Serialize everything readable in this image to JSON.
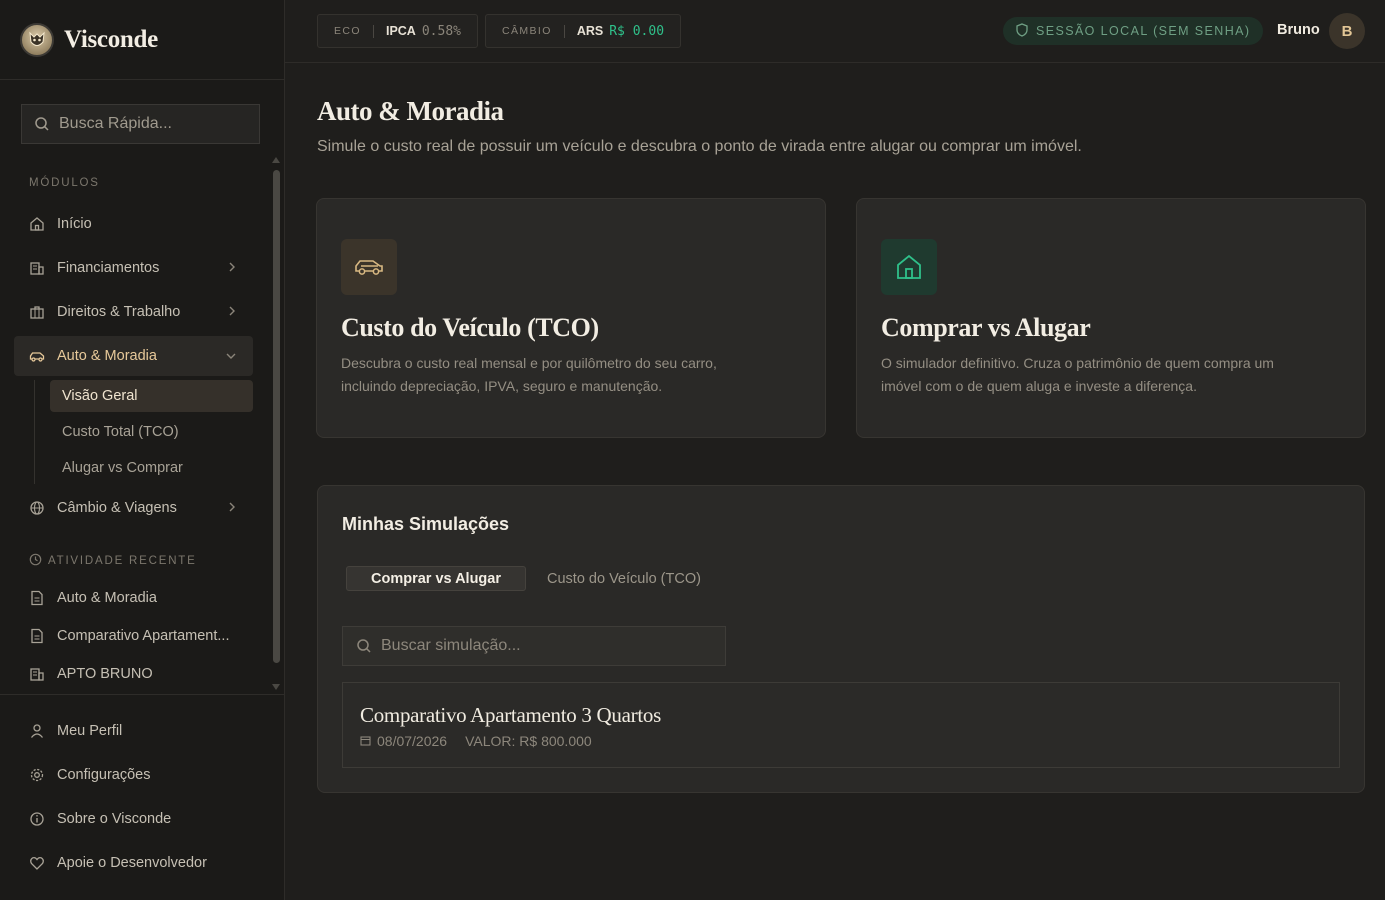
{
  "brand": {
    "name": "Visconde",
    "logo_icon": "owl-crest-icon"
  },
  "sidebar": {
    "search_placeholder": "Busca Rápida...",
    "modules_label": "MÓDULOS",
    "items": [
      {
        "label": "Início",
        "icon": "home-icon"
      },
      {
        "label": "Financiamentos",
        "icon": "building-icon"
      },
      {
        "label": "Direitos & Trabalho",
        "icon": "briefcase-icon"
      },
      {
        "label": "Auto & Moradia",
        "icon": "car-icon",
        "active": true
      },
      {
        "label": "Câmbio & Viagens",
        "icon": "globe-icon"
      }
    ],
    "subitems": [
      {
        "label": "Visão Geral",
        "active": true
      },
      {
        "label": "Custo Total (TCO)"
      },
      {
        "label": "Alugar vs Comprar"
      }
    ],
    "recent_label": "ATIVIDADE RECENTE",
    "recent": [
      {
        "label": "Auto & Moradia",
        "icon": "document-icon"
      },
      {
        "label": "Comparativo Apartament...",
        "icon": "document-icon"
      },
      {
        "label": "APTO BRUNO",
        "icon": "building-icon"
      }
    ],
    "bottom": [
      {
        "label": "Meu Perfil",
        "icon": "user-icon"
      },
      {
        "label": "Configurações",
        "icon": "gear-icon"
      },
      {
        "label": "Sobre o Visconde",
        "icon": "info-icon"
      },
      {
        "label": "Apoie o Desenvolvedor",
        "icon": "heart-icon"
      }
    ]
  },
  "topbar": {
    "ticker1": {
      "tag": "ECO",
      "label": "IPCA",
      "value": "0.58%"
    },
    "ticker2": {
      "tag": "CÂMBIO",
      "label": "ARS",
      "value": "R$ 0.00"
    },
    "session": "SESSÃO LOCAL (SEM SENHA)",
    "user_name": "Bruno",
    "avatar_initial": "B"
  },
  "main": {
    "title": "Auto & Moradia",
    "subtitle": "Simule o custo real de possuir um veículo e descubra o ponto de virada entre alugar ou comprar um imóvel.",
    "cards": [
      {
        "title": "Custo do Veículo (TCO)",
        "description": "Descubra o custo real mensal e por quilômetro do seu carro, incluindo depreciação, IPVA, seguro e manutenção.",
        "icon": "car-icon"
      },
      {
        "title": "Comprar vs Alugar",
        "description": "O simulador definitivo. Cruza o patrimônio de quem compra um imóvel com o de quem aluga e investe a diferença.",
        "icon": "home-icon"
      }
    ]
  },
  "simulations": {
    "title": "Minhas Simulações",
    "tabs": [
      "Comprar vs Alugar",
      "Custo do Veículo (TCO)"
    ],
    "search_placeholder": "Buscar simulação...",
    "items": [
      {
        "title": "Comparativo Apartamento 3 Quartos",
        "date": "08/07/2026",
        "value": "VALOR: R$ 800.000"
      }
    ]
  },
  "colors": {
    "accent_gold": "#e7c99a",
    "accent_green": "#2fc08a",
    "session_bg": "#1f3027"
  }
}
